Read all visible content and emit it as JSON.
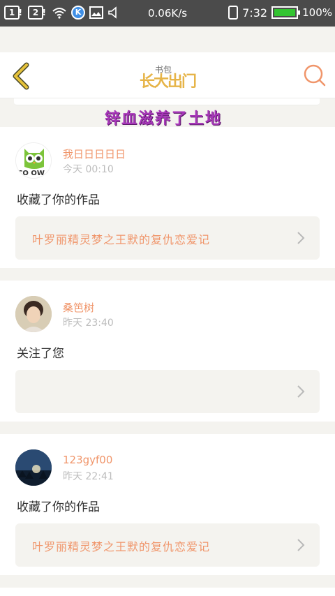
{
  "status_bar": {
    "sim1": "1",
    "sim2": "2",
    "net_speed": "0.06K/s",
    "time": "7:32",
    "battery_pct": "100%",
    "battery_level": 1.0,
    "battery_color": "#33c431",
    "k_label": "K"
  },
  "header": {
    "title_small": "书包",
    "title_main": "长大出门",
    "sticker_text": "锌血滋养了土地"
  },
  "notifications": [
    {
      "username": "我日日日日日",
      "time": "今天 00:10",
      "message": "收藏了你的作品",
      "ref_title": "叶罗丽精灵梦之王默的复仇恋爱记",
      "avatar_caption": "CO OW"
    },
    {
      "username": "桑笆树",
      "time": "昨天 23:40",
      "message": "关注了您",
      "ref_title": ""
    },
    {
      "username": "123gyf00",
      "time": "昨天 22:41",
      "message": "收藏了你的作品",
      "ref_title": "叶罗丽精灵梦之王默的复仇恋爱记"
    }
  ],
  "colors": {
    "accent": "#f0956a",
    "back_arrow": "#e6c23a",
    "search_icon": "#f0956a",
    "page_bg": "#f4f3ef"
  }
}
